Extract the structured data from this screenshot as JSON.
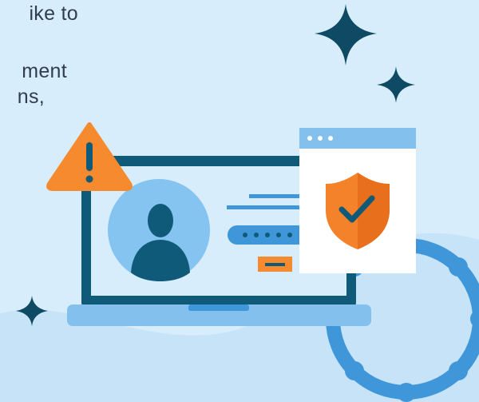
{
  "intro_text": {
    "line1": "ike to",
    "line2": "ment",
    "line3": "ns,"
  },
  "colors": {
    "background": "#d8edfb",
    "laptop_dark": "#0e5a78",
    "laptop_base": "#83c0ee",
    "avatar_circle": "#85c3f0",
    "warning": "#f58a2e",
    "shield": "#f3822a",
    "sparkle": "#0f4a64",
    "gear": "#3f97d9",
    "text": "#2f3d50"
  },
  "password_field": {
    "masked_dots": 5
  }
}
